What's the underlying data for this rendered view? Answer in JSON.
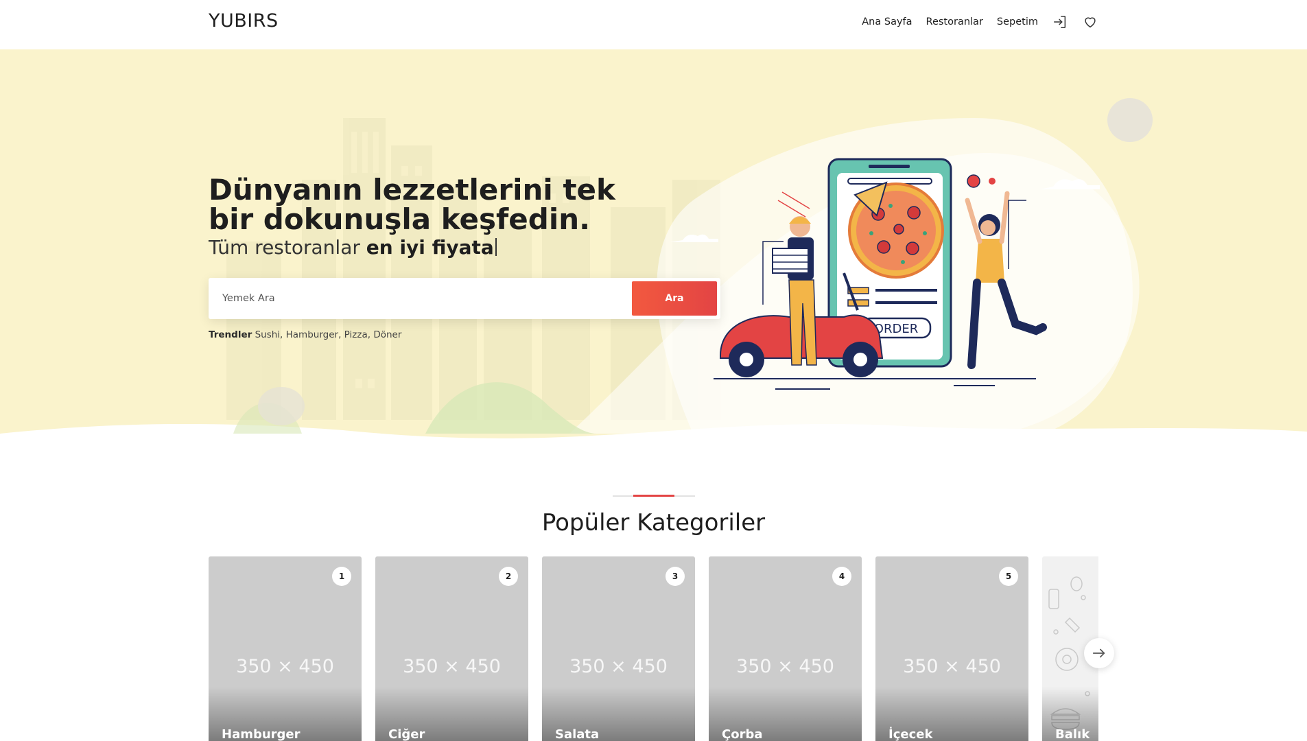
{
  "header": {
    "logo": "YUBIRS",
    "nav": [
      {
        "label": "Ana Sayfa"
      },
      {
        "label": "Restoranlar"
      },
      {
        "label": "Sepetim"
      }
    ],
    "icons": [
      "login-icon",
      "heart-icon"
    ]
  },
  "hero": {
    "title": "Dünyanın lezzetlerini tek bir dokunuşla keşfedin.",
    "subtitle_prefix": "Tüm restoranlar",
    "subtitle_highlight": "en iyi fiyata",
    "search": {
      "placeholder": "Yemek Ara",
      "button_label": "Ara"
    },
    "trends": {
      "label": "Trendler",
      "items": [
        "Sushi",
        "Hamburger",
        "Pizza",
        "Döner"
      ]
    },
    "illustration_text": "ORDER"
  },
  "categories": {
    "title": "Popüler Kategoriler",
    "placeholder_text": "350 × 450",
    "items": [
      {
        "number": "1",
        "name": "Hamburger"
      },
      {
        "number": "2",
        "name": "Ciğer"
      },
      {
        "number": "3",
        "name": "Salata"
      },
      {
        "number": "4",
        "name": "Çorba"
      },
      {
        "number": "5",
        "name": "İçecek"
      },
      {
        "number": "",
        "name": "Balık"
      }
    ],
    "next_icon": "arrow-right-icon"
  },
  "colors": {
    "hero_bg": "#faf3cc",
    "accent": "#e34444",
    "button_gradient_start": "#f2593f",
    "card_placeholder": "#cccccc"
  }
}
